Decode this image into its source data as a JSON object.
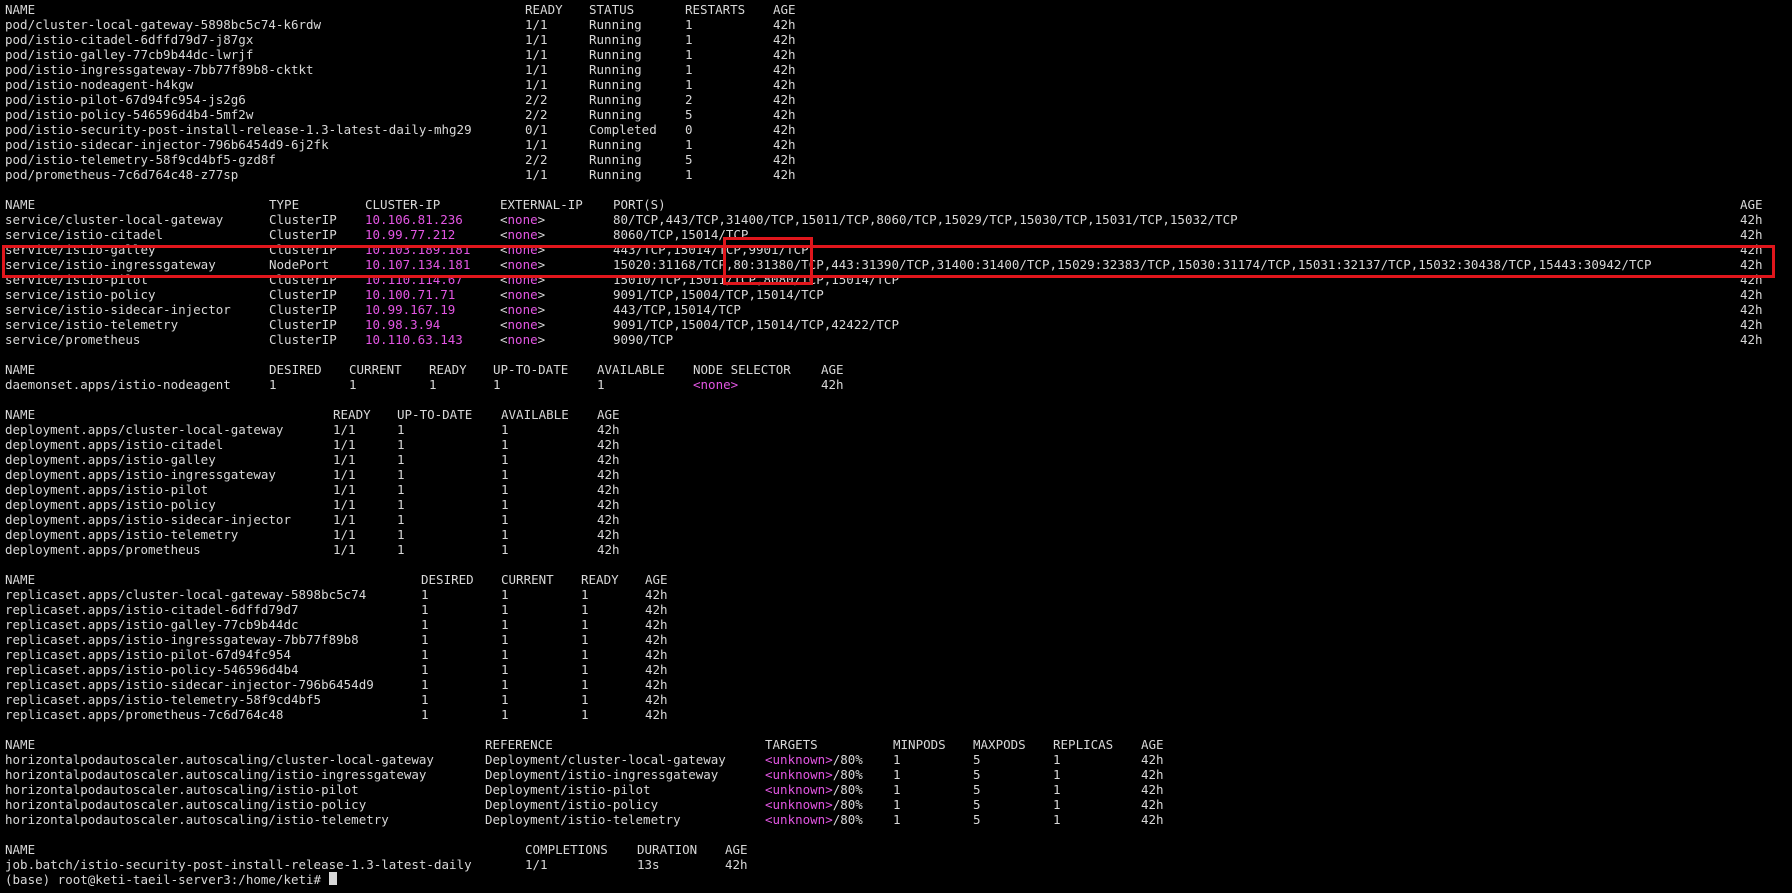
{
  "terminal": {
    "sections": [
      {
        "name": "pods",
        "headers": [
          "NAME",
          "READY",
          "STATUS",
          "RESTARTS",
          "AGE"
        ],
        "rows": [
          [
            "pod/cluster-local-gateway-5898bc5c74-k6rdw",
            "1/1",
            "Running",
            "1",
            "42h"
          ],
          [
            "pod/istio-citadel-6dffd79d7-j87gx",
            "1/1",
            "Running",
            "1",
            "42h"
          ],
          [
            "pod/istio-galley-77cb9b44dc-lwrjf",
            "1/1",
            "Running",
            "1",
            "42h"
          ],
          [
            "pod/istio-ingressgateway-7bb77f89b8-cktkt",
            "1/1",
            "Running",
            "1",
            "42h"
          ],
          [
            "pod/istio-nodeagent-h4kgw",
            "1/1",
            "Running",
            "1",
            "42h"
          ],
          [
            "pod/istio-pilot-67d94fc954-js2g6",
            "2/2",
            "Running",
            "2",
            "42h"
          ],
          [
            "pod/istio-policy-546596d4b4-5mf2w",
            "2/2",
            "Running",
            "5",
            "42h"
          ],
          [
            "pod/istio-security-post-install-release-1.3-latest-daily-mhg29",
            "0/1",
            "Completed",
            "0",
            "42h"
          ],
          [
            "pod/istio-sidecar-injector-796b6454d9-6j2fk",
            "1/1",
            "Running",
            "1",
            "42h"
          ],
          [
            "pod/istio-telemetry-58f9cd4bf5-gzd8f",
            "2/2",
            "Running",
            "5",
            "42h"
          ],
          [
            "pod/prometheus-7c6d764c48-z77sp",
            "1/1",
            "Running",
            "1",
            "42h"
          ]
        ]
      },
      {
        "name": "services",
        "headers": [
          "NAME",
          "TYPE",
          "CLUSTER-IP",
          "EXTERNAL-IP",
          "PORT(S)",
          "AGE"
        ],
        "rows": [
          [
            "service/cluster-local-gateway",
            "ClusterIP",
            "10.106.81.236",
            "<none>",
            "80/TCP,443/TCP,31400/TCP,15011/TCP,8060/TCP,15029/TCP,15030/TCP,15031/TCP,15032/TCP",
            "42h"
          ],
          [
            "service/istio-citadel",
            "ClusterIP",
            "10.99.77.212",
            "<none>",
            "8060/TCP,15014/TCP",
            "42h"
          ],
          [
            "service/istio-galley",
            "ClusterIP",
            "10.103.189.181",
            "<none>",
            "443/TCP,15014/TCP,9901/TCP",
            "42h"
          ],
          [
            "service/istio-ingressgateway",
            "NodePort",
            "10.107.134.181",
            "<none>",
            "15020:31168/TCP,80:31380/TCP,443:31390/TCP,31400:31400/TCP,15029:32383/TCP,15030:31174/TCP,15031:32137/TCP,15032:30438/TCP,15443:30942/TCP",
            "42h"
          ],
          [
            "service/istio-pilot",
            "ClusterIP",
            "10.110.114.67",
            "<none>",
            "15010/TCP,15011/TCP,8080/TCP,15014/TCP",
            "42h"
          ],
          [
            "service/istio-policy",
            "ClusterIP",
            "10.100.71.71",
            "<none>",
            "9091/TCP,15004/TCP,15014/TCP",
            "42h"
          ],
          [
            "service/istio-sidecar-injector",
            "ClusterIP",
            "10.99.167.19",
            "<none>",
            "443/TCP,15014/TCP",
            "42h"
          ],
          [
            "service/istio-telemetry",
            "ClusterIP",
            "10.98.3.94",
            "<none>",
            "9091/TCP,15004/TCP,15014/TCP,42422/TCP",
            "42h"
          ],
          [
            "service/prometheus",
            "ClusterIP",
            "10.110.63.143",
            "<none>",
            "9090/TCP",
            "42h"
          ]
        ]
      },
      {
        "name": "daemonsets",
        "headers": [
          "NAME",
          "DESIRED",
          "CURRENT",
          "READY",
          "UP-TO-DATE",
          "AVAILABLE",
          "NODE SELECTOR",
          "AGE"
        ],
        "rows": [
          [
            "daemonset.apps/istio-nodeagent",
            "1",
            "1",
            "1",
            "1",
            "1",
            "<none>",
            "42h"
          ]
        ]
      },
      {
        "name": "deployments",
        "headers": [
          "NAME",
          "READY",
          "UP-TO-DATE",
          "AVAILABLE",
          "AGE"
        ],
        "rows": [
          [
            "deployment.apps/cluster-local-gateway",
            "1/1",
            "1",
            "1",
            "42h"
          ],
          [
            "deployment.apps/istio-citadel",
            "1/1",
            "1",
            "1",
            "42h"
          ],
          [
            "deployment.apps/istio-galley",
            "1/1",
            "1",
            "1",
            "42h"
          ],
          [
            "deployment.apps/istio-ingressgateway",
            "1/1",
            "1",
            "1",
            "42h"
          ],
          [
            "deployment.apps/istio-pilot",
            "1/1",
            "1",
            "1",
            "42h"
          ],
          [
            "deployment.apps/istio-policy",
            "1/1",
            "1",
            "1",
            "42h"
          ],
          [
            "deployment.apps/istio-sidecar-injector",
            "1/1",
            "1",
            "1",
            "42h"
          ],
          [
            "deployment.apps/istio-telemetry",
            "1/1",
            "1",
            "1",
            "42h"
          ],
          [
            "deployment.apps/prometheus",
            "1/1",
            "1",
            "1",
            "42h"
          ]
        ]
      },
      {
        "name": "replicasets",
        "headers": [
          "NAME",
          "DESIRED",
          "CURRENT",
          "READY",
          "AGE"
        ],
        "rows": [
          [
            "replicaset.apps/cluster-local-gateway-5898bc5c74",
            "1",
            "1",
            "1",
            "42h"
          ],
          [
            "replicaset.apps/istio-citadel-6dffd79d7",
            "1",
            "1",
            "1",
            "42h"
          ],
          [
            "replicaset.apps/istio-galley-77cb9b44dc",
            "1",
            "1",
            "1",
            "42h"
          ],
          [
            "replicaset.apps/istio-ingressgateway-7bb77f89b8",
            "1",
            "1",
            "1",
            "42h"
          ],
          [
            "replicaset.apps/istio-pilot-67d94fc954",
            "1",
            "1",
            "1",
            "42h"
          ],
          [
            "replicaset.apps/istio-policy-546596d4b4",
            "1",
            "1",
            "1",
            "42h"
          ],
          [
            "replicaset.apps/istio-sidecar-injector-796b6454d9",
            "1",
            "1",
            "1",
            "42h"
          ],
          [
            "replicaset.apps/istio-telemetry-58f9cd4bf5",
            "1",
            "1",
            "1",
            "42h"
          ],
          [
            "replicaset.apps/prometheus-7c6d764c48",
            "1",
            "1",
            "1",
            "42h"
          ]
        ]
      },
      {
        "name": "hpas",
        "headers": [
          "NAME",
          "REFERENCE",
          "TARGETS",
          "MINPODS",
          "MAXPODS",
          "REPLICAS",
          "AGE"
        ],
        "rows": [
          [
            "horizontalpodautoscaler.autoscaling/cluster-local-gateway",
            "Deployment/cluster-local-gateway",
            "<unknown>/80%",
            "1",
            "5",
            "1",
            "42h"
          ],
          [
            "horizontalpodautoscaler.autoscaling/istio-ingressgateway",
            "Deployment/istio-ingressgateway",
            "<unknown>/80%",
            "1",
            "5",
            "1",
            "42h"
          ],
          [
            "horizontalpodautoscaler.autoscaling/istio-pilot",
            "Deployment/istio-pilot",
            "<unknown>/80%",
            "1",
            "5",
            "1",
            "42h"
          ],
          [
            "horizontalpodautoscaler.autoscaling/istio-policy",
            "Deployment/istio-policy",
            "<unknown>/80%",
            "1",
            "5",
            "1",
            "42h"
          ],
          [
            "horizontalpodautoscaler.autoscaling/istio-telemetry",
            "Deployment/istio-telemetry",
            "<unknown>/80%",
            "1",
            "5",
            "1",
            "42h"
          ]
        ]
      },
      {
        "name": "jobs",
        "headers": [
          "NAME",
          "COMPLETIONS",
          "DURATION",
          "AGE"
        ],
        "rows": [
          [
            "job.batch/istio-security-post-install-release-1.3-latest-daily",
            "1/1",
            "13s",
            "42h"
          ]
        ]
      }
    ],
    "prompt": "(base) root@keti-taeil-server3:/home/keti# ",
    "colors": {
      "background": "#000000",
      "text": "#d8d8d8",
      "cluster_ip": "#e356e3",
      "highlight_box": "#e0161c"
    }
  }
}
